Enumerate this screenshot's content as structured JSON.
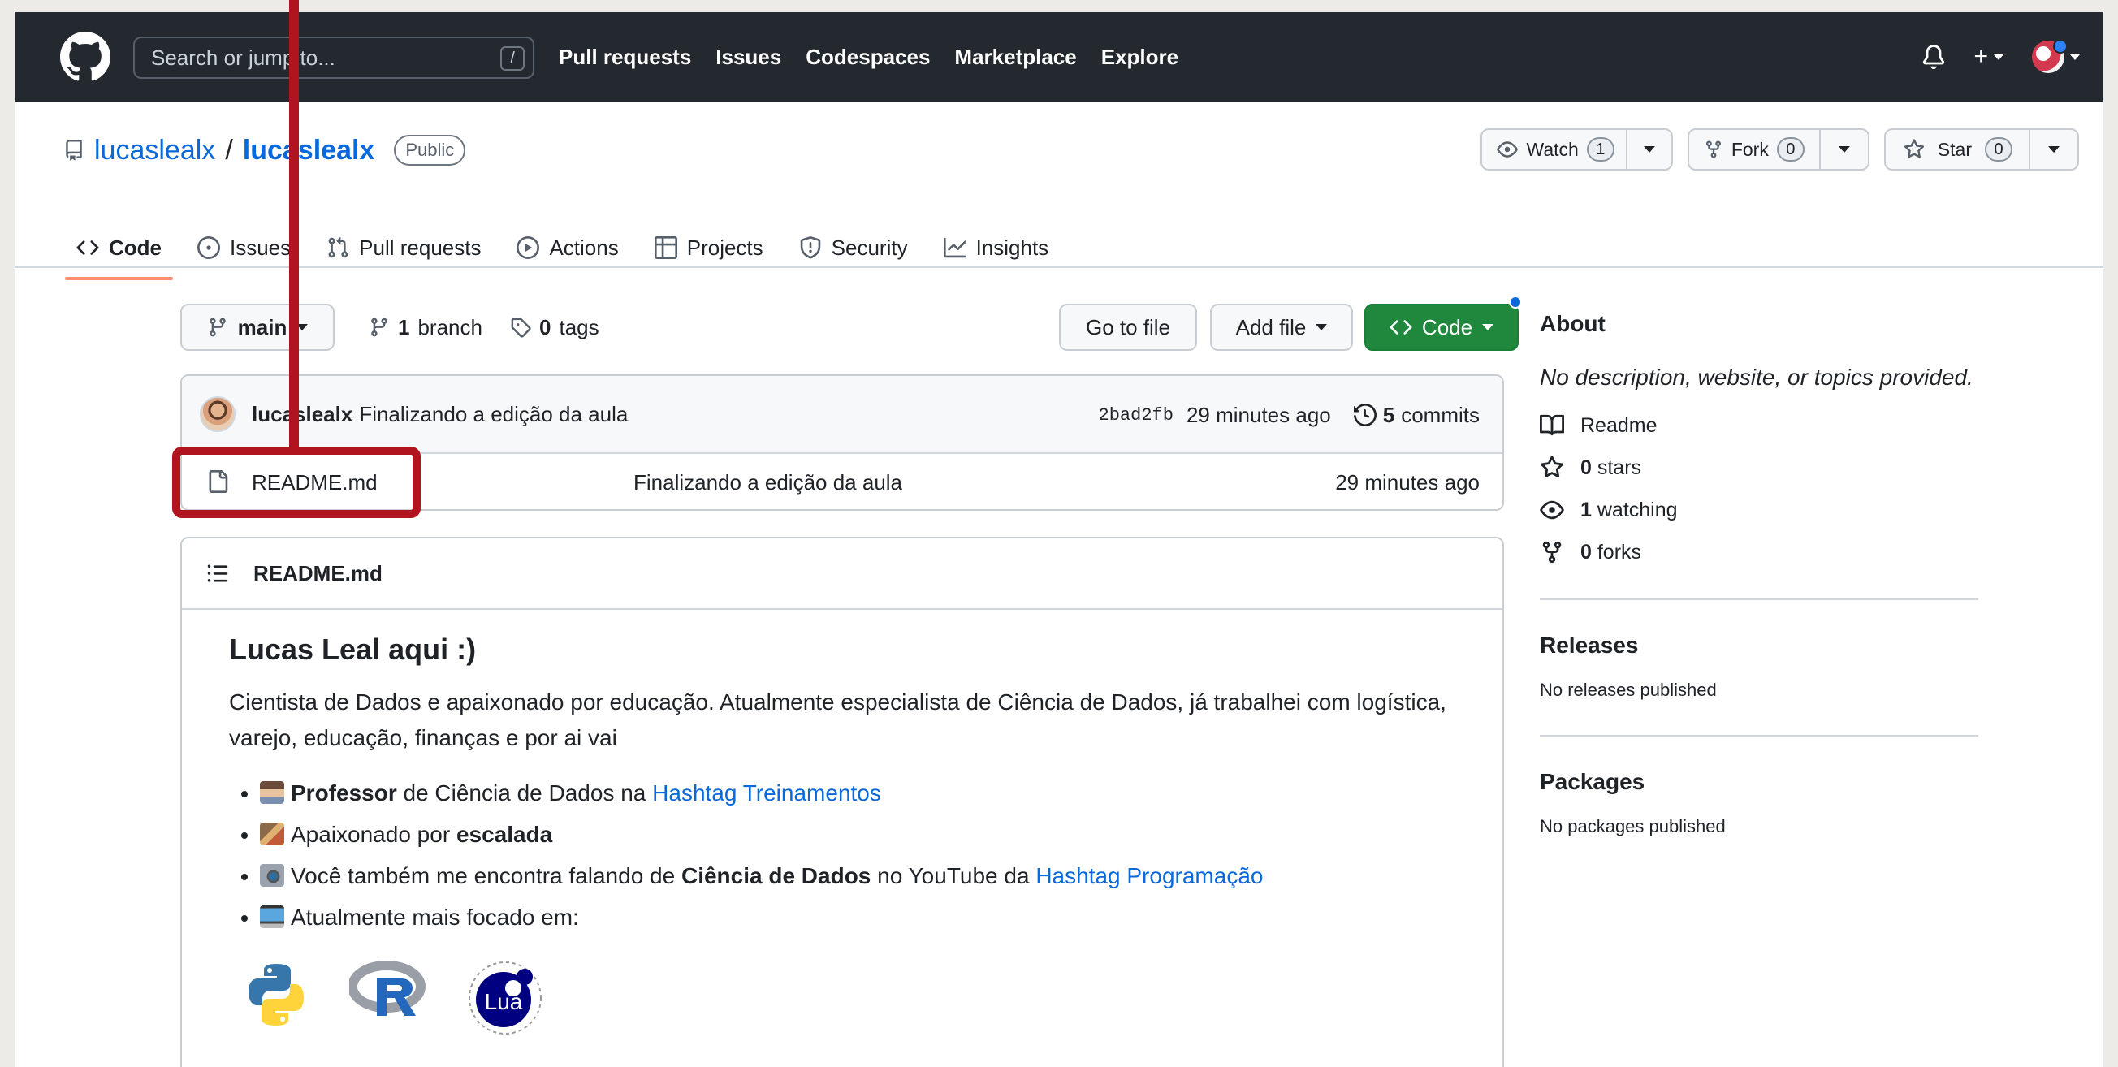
{
  "header": {
    "search_placeholder": "Search or jump to...",
    "search_shortcut": "/",
    "nav": [
      "Pull requests",
      "Issues",
      "Codespaces",
      "Marketplace",
      "Explore"
    ]
  },
  "repo": {
    "owner": "lucaslealx",
    "separator": "/",
    "name": "lucaslealx",
    "visibility": "Public",
    "watch_label": "Watch",
    "watch_count": "1",
    "fork_label": "Fork",
    "fork_count": "0",
    "star_label": "Star",
    "star_count": "0"
  },
  "tabs": [
    "Code",
    "Issues",
    "Pull requests",
    "Actions",
    "Projects",
    "Security",
    "Insights"
  ],
  "branch": {
    "current": "main",
    "branch_count": "1",
    "branch_label": "branch",
    "tag_count": "0",
    "tag_label": "tags",
    "go_to_file": "Go to file",
    "add_file": "Add file",
    "code": "Code"
  },
  "commit": {
    "author": "lucaslealx",
    "message": "Finalizando a edição da aula",
    "hash": "2bad2fb",
    "age": "29 minutes ago",
    "commit_count": "5",
    "commit_label": "commits"
  },
  "files": [
    {
      "name": "README.md",
      "message": "Finalizando a edição da aula",
      "age": "29 minutes ago"
    }
  ],
  "readme": {
    "filename": "README.md",
    "heading": "Lucas Leal aqui :)",
    "intro": "Cientista de Dados e apaixonado por educação. Atualmente especialista de Ciência de Dados, já trabalhei com logística, varejo, educação, finanças e por ai vai",
    "bullets": [
      {
        "bold": "Professor",
        "text": " de Ciência de Dados na ",
        "link": "Hashtag Treinamentos"
      },
      {
        "pre": "Apaixonado por ",
        "bold": "escalada"
      },
      {
        "pre": "Você também me encontra falando de ",
        "bold": "Ciência de Dados",
        "text": " no YouTube da ",
        "link": "Hashtag Programação"
      },
      {
        "pre": "Atualmente mais focado em:"
      }
    ],
    "logo_lua_text": "Lua"
  },
  "about": {
    "title": "About",
    "description": "No description, website, or topics provided.",
    "readme_label": "Readme",
    "stars_count": "0",
    "stars_label": "stars",
    "watching_count": "1",
    "watching_label": "watching",
    "forks_count": "0",
    "forks_label": "forks"
  },
  "releases": {
    "title": "Releases",
    "empty": "No releases published"
  },
  "packages": {
    "title": "Packages",
    "empty": "No packages published"
  },
  "colors": {
    "annotation": "#b0141e",
    "primary_button": "#1f883d",
    "link": "#0969da"
  }
}
